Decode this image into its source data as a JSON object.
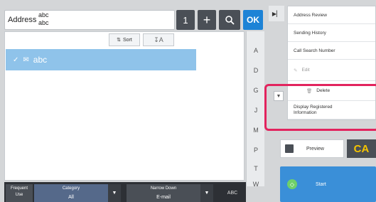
{
  "address_bar": {
    "label": "Address",
    "values": [
      "abc",
      "abc"
    ],
    "count_button": "1",
    "add_button": "+",
    "ok_button": "OK"
  },
  "list": {
    "sort_label": "Sort",
    "sort_alt_label": "A",
    "rows": [
      {
        "name": "abc",
        "selected": true
      }
    ]
  },
  "index": [
    "A",
    "D",
    "G",
    "J",
    "M",
    "P",
    "T",
    "W"
  ],
  "bottom_bar": {
    "frequent_use_line1": "Frequent",
    "frequent_use_line2": "Use",
    "category_label": "Category",
    "category_value": "All",
    "narrow_down_label": "Narrow Down",
    "narrow_down_value": "E-mail",
    "abc_label": "ABC"
  },
  "right_panel": {
    "menu_items": [
      {
        "label": "Address Review",
        "dim": false
      },
      {
        "label": "Sending History",
        "dim": false
      },
      {
        "label": "Call Search Number",
        "dim": false
      },
      {
        "label": "Edit",
        "dim": true
      },
      {
        "label": "Delete",
        "dim": false
      },
      {
        "label": "Display Registered Information",
        "dim": false
      }
    ],
    "preview_label": "Preview",
    "ca_label": "CA",
    "start_label": "Start"
  },
  "colors": {
    "accent": "#1d83d6",
    "selected_row": "#8fc3ea",
    "highlight_box": "#e2245e",
    "ca_text": "#f5c400",
    "start": "#3a8fd8"
  }
}
